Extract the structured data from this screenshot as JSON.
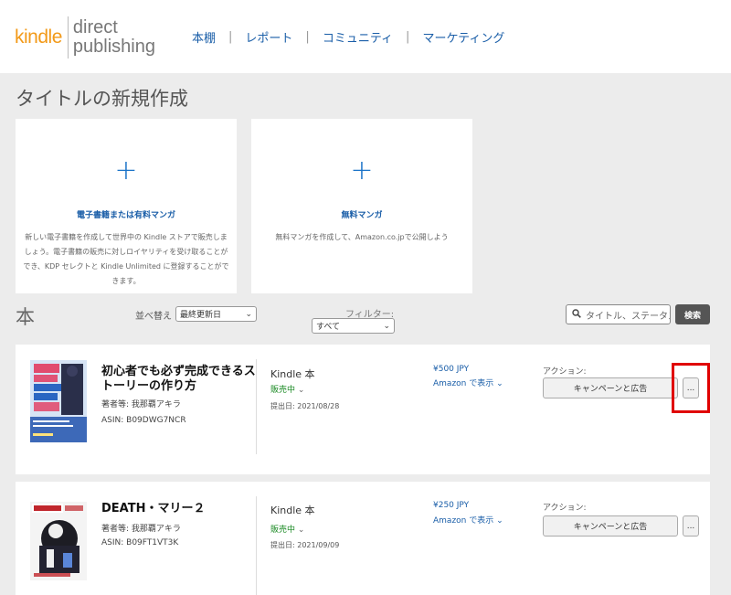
{
  "header": {
    "logo_kindle": "kindle",
    "logo_direct": "direct",
    "logo_publishing": "publishing",
    "nav": [
      "本棚",
      "レポート",
      "コミュニティ",
      "マーケティング"
    ],
    "nav_separator": "|"
  },
  "page_title": "タイトルの新規作成",
  "create_cards": [
    {
      "plus": "+",
      "title": "電子書籍または有料マンガ",
      "description": "新しい電子書籍を作成して世界中の Kindle ストアで販売しましょう。電子書籍の販売に対しロイヤリティを受け取ることができ、KDP セレクトと Kindle Unlimited に登録することができます。"
    },
    {
      "plus": "+",
      "title": "無料マンガ",
      "description": "無料マンガを作成して、Amazon.co.jpで公開しよう"
    }
  ],
  "books_section": {
    "label": "本",
    "sort_label": "並べ替え",
    "sort_value": "最終更新日",
    "filter_label": "フィルター:",
    "filter_value": "すべて",
    "search_placeholder": "タイトル、ステータス",
    "search_button": "検索"
  },
  "books": [
    {
      "title": "初心者でも必ず完成できるストーリーの作り方",
      "author": "著者等: 我那覇アキラ",
      "asin": "ASIN: B09DWG7NCR",
      "format": "Kindle 本",
      "status": "販売中",
      "submitted": "提出日: 2021/08/28",
      "price": "¥500 JPY",
      "amazon_link": "Amazon で表示",
      "actions_label": "アクション:",
      "campaign_button": "キャンペーンと広告",
      "more_button": "..."
    },
    {
      "title": "DEATH・マリー２",
      "author": "著者等: 我那覇アキラ",
      "asin": "ASIN: B09FT1VT3K",
      "format": "Kindle 本",
      "status": "販売中",
      "submitted": "提出日: 2021/09/09",
      "price": "¥250 JPY",
      "amazon_link": "Amazon で表示",
      "actions_label": "アクション:",
      "campaign_button": "キャンペーンと広告",
      "more_button": "..."
    }
  ],
  "icons": {
    "search": "search-icon",
    "chevron": "chevron-down-icon"
  },
  "colors": {
    "kindle_orange": "#f29a1a",
    "link_blue": "#1a5ea8",
    "status_green": "#1b8a24",
    "highlight_red": "#e00000"
  }
}
